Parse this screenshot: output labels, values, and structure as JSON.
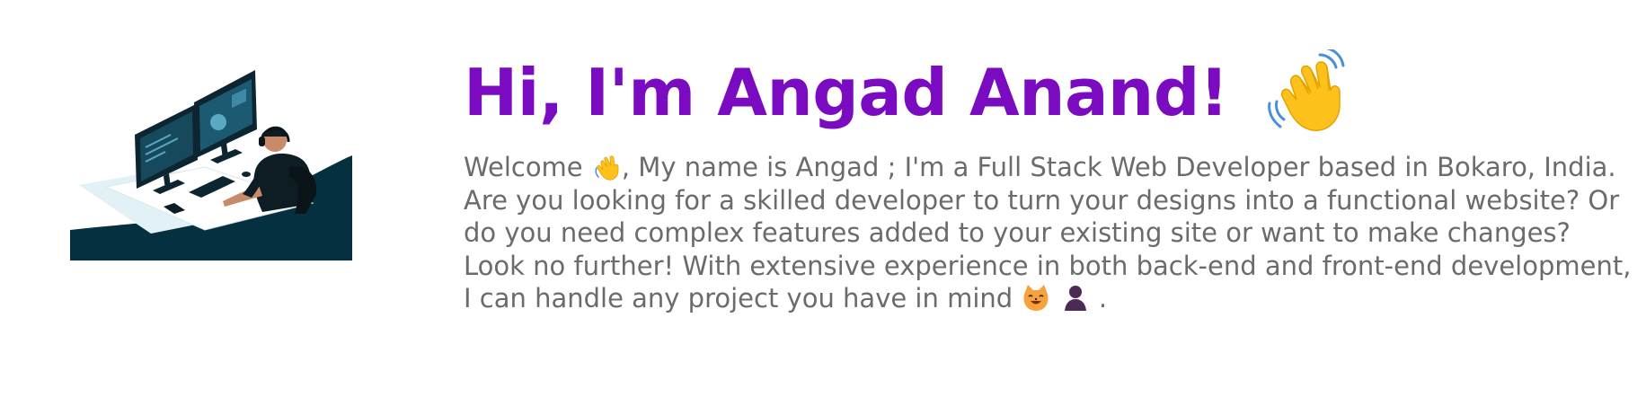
{
  "hero": {
    "illustration_name": "developer-at-desk-illustration",
    "headline": "Hi, I'm Angad Anand!",
    "headline_icon": "waving-hand-icon",
    "intro": {
      "part1": "Welcome",
      "wave_icon": "waving-hand-icon",
      "part2": ", My name is Angad ; I'm a Full Stack Web Developer based in Bokaro, India. Are you looking for a skilled developer to turn your designs into a functional website? Or do you need complex features added to your existing site or want to make changes? Look no further! With extensive experience in both back-end and front-end development, I can handle any project you have in mind",
      "cat_icon": "smiling-cat-icon",
      "person_icon": "person-silhouette-icon",
      "end": "."
    }
  },
  "colors": {
    "headline": "#7a0bc0",
    "body_text": "#6b6b6b",
    "illustration_dark": "#04303f",
    "background": "#ffffff"
  }
}
